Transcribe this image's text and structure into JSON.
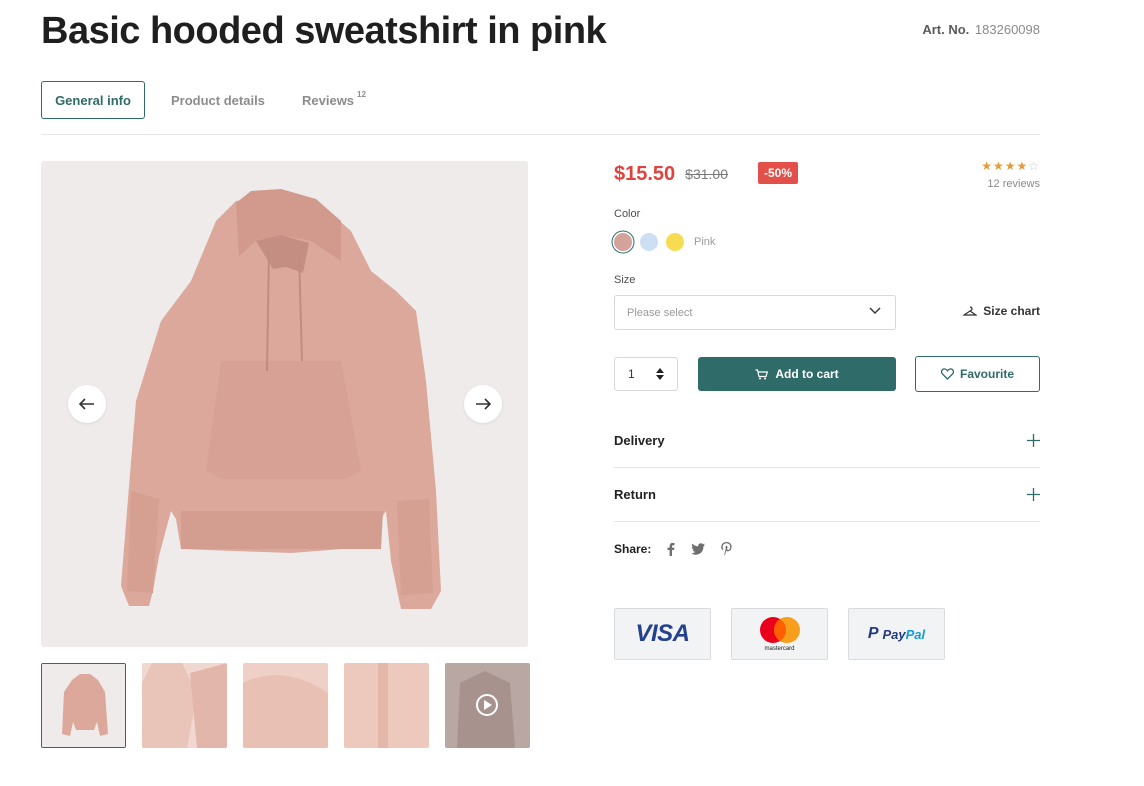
{
  "product": {
    "title": "Basic hooded sweatshirt in pink",
    "art_label": "Art. No.",
    "art_number": "183260098"
  },
  "tabs": [
    {
      "label": "General info",
      "active": true
    },
    {
      "label": "Product details",
      "active": false
    },
    {
      "label": "Reviews",
      "badge": "12",
      "active": false
    }
  ],
  "gallery": {
    "prev_icon": "arrow-left-icon",
    "next_icon": "arrow-right-icon",
    "thumbnails": [
      "front",
      "detail-hood",
      "detail-neck",
      "detail-fabric",
      "video"
    ]
  },
  "pricing": {
    "current": "$15.50",
    "original": "$31.00",
    "discount": "-50%"
  },
  "rating": {
    "stars": 4,
    "max": 5,
    "reviews_label": "12 reviews"
  },
  "color": {
    "label": "Color",
    "selected_name": "Pink",
    "options": [
      "#d3a39b",
      "#cde0f3",
      "#f7dc52"
    ]
  },
  "size": {
    "label": "Size",
    "placeholder": "Please select",
    "chart_label": "Size chart"
  },
  "cart": {
    "quantity": "1",
    "add_label": "Add to cart",
    "favourite_label": "Favourite"
  },
  "accordion": [
    {
      "label": "Delivery"
    },
    {
      "label": "Return"
    }
  ],
  "share": {
    "label": "Share:",
    "icons": [
      "facebook-icon",
      "twitter-icon",
      "pinterest-icon"
    ]
  },
  "payments": {
    "visa": "VISA",
    "mastercard": "mastercard",
    "paypal_pay": "Pay",
    "paypal_pal": "Pal"
  },
  "colors": {
    "accent": "#2f6b68",
    "sale": "#e0423c",
    "star": "#e59a34"
  }
}
